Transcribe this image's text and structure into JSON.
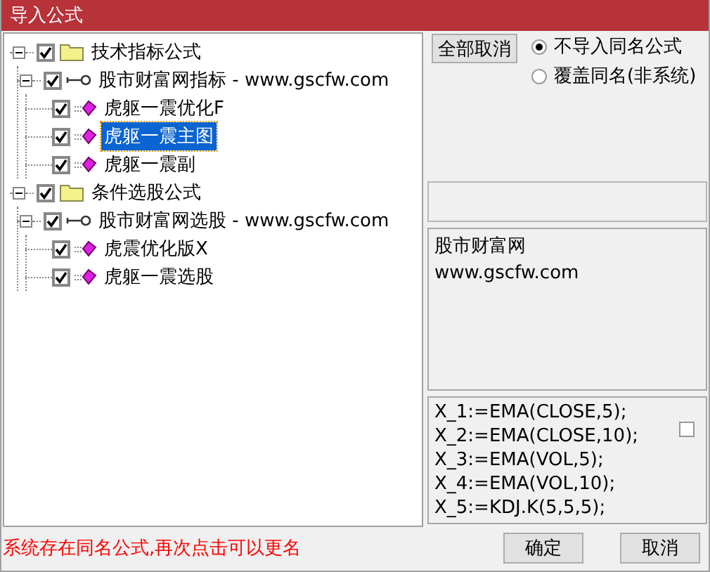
{
  "window": {
    "title": "导入公式"
  },
  "tree": [
    {
      "kind": "folder",
      "label": "技术指标公式",
      "checked": true,
      "expanded": true,
      "selected": false,
      "children": [
        {
          "kind": "group",
          "label": "股市财富网指标 - www.gscfw.com",
          "checked": true,
          "expanded": true,
          "selected": false,
          "children": [
            {
              "kind": "formula",
              "label": "虎躯一震优化F",
              "checked": true,
              "selected": false
            },
            {
              "kind": "formula",
              "label": "虎躯一震主图",
              "checked": true,
              "selected": true
            },
            {
              "kind": "formula",
              "label": "虎躯一震副",
              "checked": true,
              "selected": false
            }
          ]
        }
      ]
    },
    {
      "kind": "folder",
      "label": "条件选股公式",
      "checked": true,
      "expanded": true,
      "selected": false,
      "children": [
        {
          "kind": "group",
          "label": "股市财富网选股 - www.gscfw.com",
          "checked": true,
          "expanded": true,
          "selected": false,
          "children": [
            {
              "kind": "formula",
              "label": "虎震优化版X",
              "checked": true,
              "selected": false
            },
            {
              "kind": "formula",
              "label": "虎躯一震选股",
              "checked": true,
              "selected": false
            }
          ]
        }
      ]
    }
  ],
  "deselect_all_button": "全部取消",
  "options": [
    {
      "label": "不导入同名公式",
      "selected": true
    },
    {
      "label": "覆盖同名(非系统)",
      "selected": false
    }
  ],
  "description": [
    "股市财富网",
    "www.gscfw.com"
  ],
  "code": {
    "lines": [
      "X_1:=EMA(CLOSE,5);",
      "X_2:=EMA(CLOSE,10);",
      "X_3:=EMA(VOL,5);",
      "X_4:=EMA(VOL,10);",
      "X_5:=KDJ.K(5,5,5);"
    ],
    "checked": false
  },
  "status_message": "系统存在同名公式,再次点击可以更名",
  "buttons": [
    "确定",
    "取消"
  ]
}
